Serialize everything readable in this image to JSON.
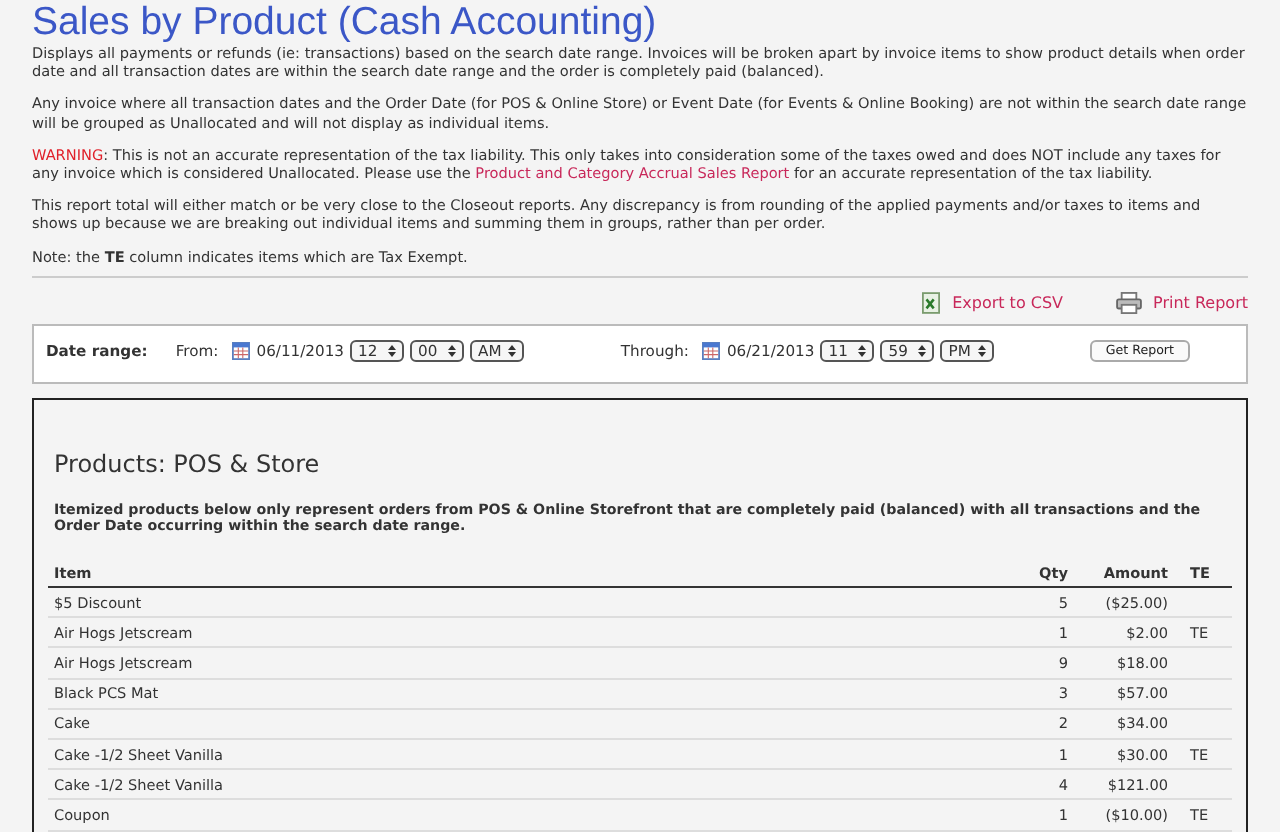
{
  "title": "Sales by Product (Cash Accounting)",
  "intro": [
    {
      "kind": "text",
      "text": "Displays all payments or refunds (ie: transactions) based on the search date range. Invoices will be broken apart by invoice items to show product details when order date and all transaction dates are within the search date range and the order is completely paid (balanced)."
    },
    {
      "kind": "text",
      "text": "Any invoice where all transaction dates and the Order Date (for POS & Online Store) or Event Date (for Events & Online Booking) are not within the search date range will be grouped as Unallocated and will not display as individual items."
    },
    {
      "kind": "warning",
      "label": "WARNING",
      "before": ": This is not an accurate representation of the tax liability. This only takes into consideration some of the taxes owed and does NOT include any taxes for any invoice which is considered Unallocated. Please use the ",
      "link": "Product and Category Accrual Sales Report",
      "after": " for an accurate representation of the tax liability."
    },
    {
      "kind": "text",
      "text": "This report total will either match or be very close to the Closeout reports. Any discrepancy is from rounding of the applied payments and/or taxes to items and shows up because we are breaking out individual items and summing them in groups, rather than per order."
    },
    {
      "kind": "text",
      "text": "Note: the **TE** column indicates items which are Tax Exempt."
    }
  ],
  "actions": [
    {
      "kind": "csv",
      "label": "Export to CSV"
    },
    {
      "kind": "print",
      "label": "Print Report"
    }
  ],
  "date_range": {
    "label": "Date range:",
    "from": {
      "label": "From:",
      "date": "06/11/2013",
      "hour": "12",
      "minute": "00",
      "ampm": "AM"
    },
    "through": {
      "label": "Through:",
      "date": "06/21/2013",
      "hour": "11",
      "minute": "59",
      "ampm": "PM"
    },
    "button": "Get Report"
  },
  "section": {
    "title": "Products: POS & Store",
    "note": "Itemized products below only represent orders from POS & Online Storefront that are completely paid (balanced) with all transactions and the Order Date occurring within the search date range.",
    "columns": [
      "Item",
      "Qty",
      "Amount",
      "TE"
    ],
    "rows": [
      {
        "item": "$5 Discount",
        "qty": "5",
        "amount": "($25.00)"
      },
      {
        "item": "Air Hogs Jetscream",
        "qty": "1",
        "amount": "$2.00",
        "te": "TE"
      },
      {
        "item": "Air Hogs Jetscream",
        "qty": "9",
        "amount": "$18.00"
      },
      {
        "item": "Black PCS Mat",
        "qty": "3",
        "amount": "$57.00"
      },
      {
        "item": "Cake",
        "qty": "2",
        "amount": "$34.00"
      },
      {
        "item": "Cake -1/2 Sheet Vanilla",
        "qty": "1",
        "amount": "$30.00",
        "te": "TE"
      },
      {
        "item": "Cake -1/2 Sheet Vanilla",
        "qty": "4",
        "amount": "$121.00"
      },
      {
        "item": "Coupon",
        "qty": "1",
        "amount": "($10.00)",
        "te": "TE"
      }
    ]
  }
}
